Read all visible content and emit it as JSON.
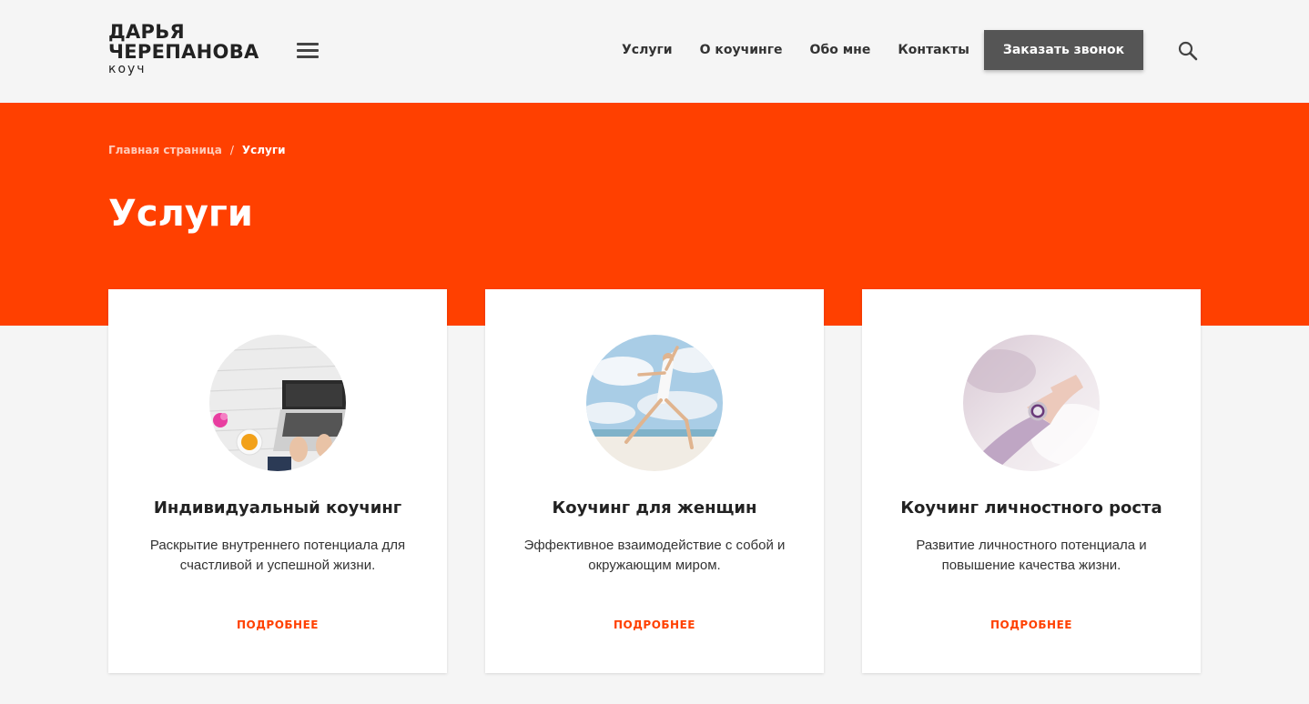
{
  "header": {
    "logo": {
      "line1": "ДАРЬЯ",
      "line2": "ЧЕРЕПАНОВА",
      "subtitle": "коуч"
    },
    "menu_icon": "hamburger-menu-icon",
    "nav": [
      {
        "label": "Услуги"
      },
      {
        "label": "О коучинге"
      },
      {
        "label": "Обо мне"
      },
      {
        "label": "Контакты"
      }
    ],
    "cta_label": "Заказать звонок",
    "search_icon": "search-icon"
  },
  "hero": {
    "breadcrumb": {
      "home": "Главная страница",
      "separator": "/",
      "current": "Услуги"
    },
    "title": "Услуги"
  },
  "cards": [
    {
      "title": "Индивидуальный коучинг",
      "description": "Раскрытие внутреннего потенциала для счастливой и успешной жизни.",
      "link": "ПОДРОБНЕЕ",
      "image": "laptop-desk-photo"
    },
    {
      "title": "Коучинг для женщин",
      "description": "Эффективное взаимодействие с собой и окружающим миром.",
      "link": "ПОДРОБНЕЕ",
      "image": "woman-jumping-beach-photo"
    },
    {
      "title": "Коучинг личностного роста",
      "description": "Развитие личностного потенциала и повышение качества жизни.",
      "link": "ПОДРОБНЕЕ",
      "image": "hand-with-watch-photo"
    }
  ],
  "colors": {
    "accent": "#ff4000",
    "button": "#555555",
    "background": "#f5f5f5"
  }
}
